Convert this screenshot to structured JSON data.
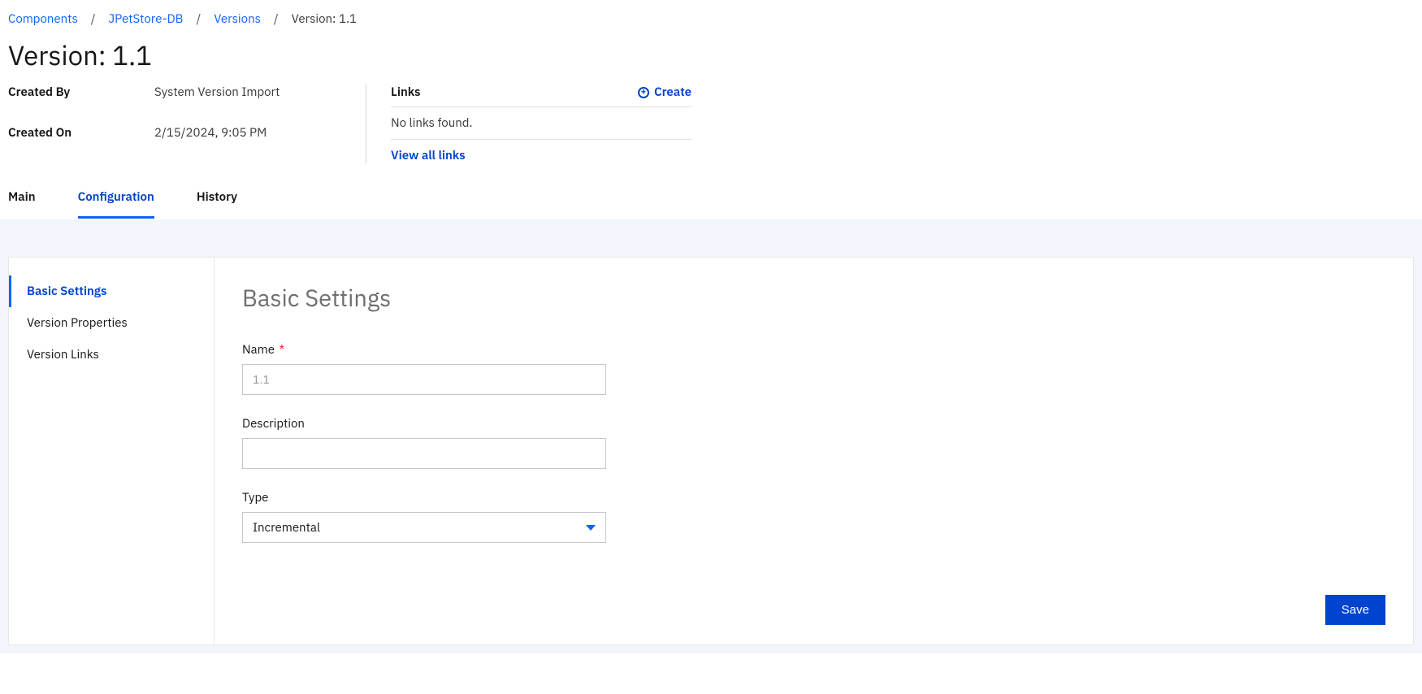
{
  "breadcrumbs": {
    "items": [
      {
        "label": "Components"
      },
      {
        "label": "JPetStore-DB"
      },
      {
        "label": "Versions"
      }
    ],
    "current": "Version: 1.1",
    "sep": "/"
  },
  "page": {
    "title": "Version: 1.1"
  },
  "meta": {
    "createdByLabel": "Created By",
    "createdByValue": "System Version Import",
    "createdOnLabel": "Created On",
    "createdOnValue": "2/15/2024, 9:05 PM"
  },
  "links": {
    "title": "Links",
    "createLabel": "Create",
    "plus": "+",
    "emptyText": "No links found.",
    "viewAll": "View all links"
  },
  "tabs": {
    "main": "Main",
    "configuration": "Configuration",
    "history": "History"
  },
  "sidenav": {
    "basicSettings": "Basic Settings",
    "versionProperties": "Version Properties",
    "versionLinks": "Version Links"
  },
  "form": {
    "sectionTitle": "Basic Settings",
    "nameLabel": "Name",
    "requiredMark": "*",
    "nameValue": "1.1",
    "descriptionLabel": "Description",
    "descriptionValue": "",
    "typeLabel": "Type",
    "typeValue": "Incremental",
    "saveLabel": "Save"
  }
}
